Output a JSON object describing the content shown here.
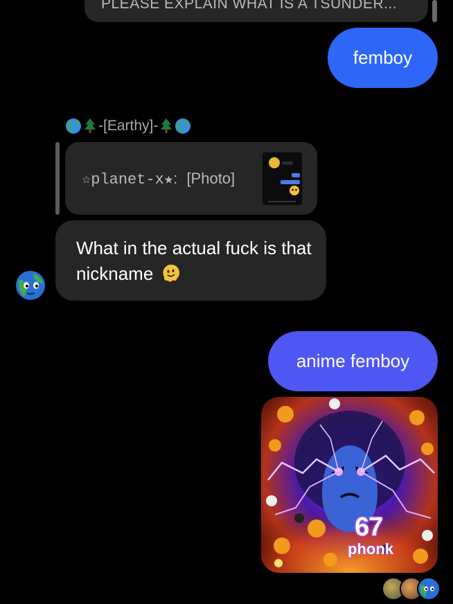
{
  "top_message": {
    "text": "PLEASE EXPLAIN WHAT IS A TSUNDER..."
  },
  "messages": {
    "sent_1": "femboy",
    "reply_sender_name": "-[Earthy]-",
    "reply_quote_sender": "☆planet-x★",
    "reply_quote_separator": ":",
    "reply_quote_content": "[Photo]",
    "received_text": "What in the actual fuck is that nickname",
    "sent_2": "anime femboy"
  },
  "photo": {
    "overlay_number": "67",
    "overlay_word": "phonk"
  },
  "icons": {
    "globe": "globe-icon",
    "tree": "evergreen-tree-icon",
    "melting_face": "melting-face-emoji",
    "avatar": "earth-avatar"
  },
  "colors": {
    "background": "#000000",
    "sent_bubble_1": "#2e67f8",
    "sent_bubble_2": "#4e57f2",
    "received_bubble": "#262626",
    "muted_text": "#a9a9a9"
  }
}
